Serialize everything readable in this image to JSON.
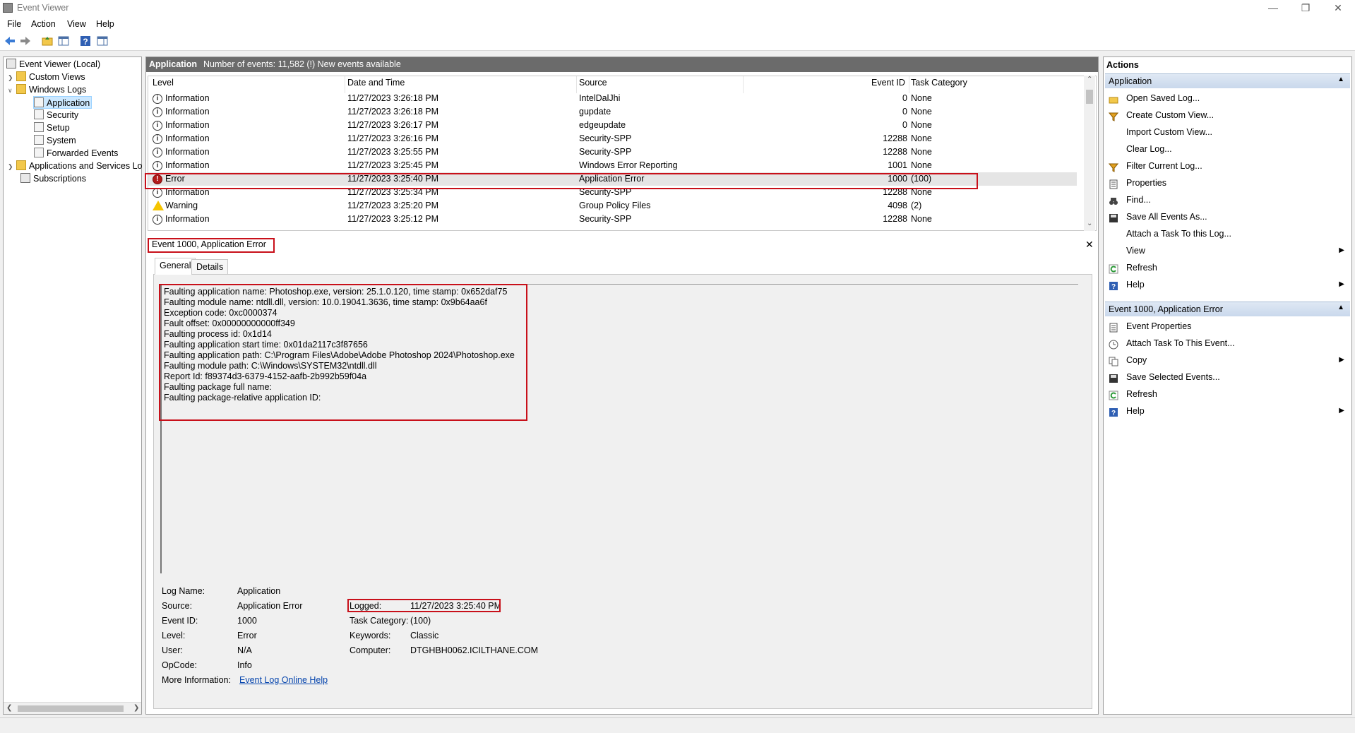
{
  "window": {
    "title": "Event Viewer"
  },
  "menu": [
    "File",
    "Action",
    "View",
    "Help"
  ],
  "toolbar": {
    "icons": [
      "back-arrow-icon",
      "forward-arrow-icon",
      "folder-up-icon",
      "show-hide-tree-icon",
      "help-icon",
      "show-hide-action-pane-icon"
    ]
  },
  "tree": {
    "root": "Event Viewer (Local)",
    "custom_views": "Custom Views",
    "windows_logs": "Windows Logs",
    "logs": [
      "Application",
      "Security",
      "Setup",
      "System",
      "Forwarded Events"
    ],
    "apps_services": "Applications and Services Lo",
    "subscriptions": "Subscriptions"
  },
  "center": {
    "header_title": "Application",
    "header_info": "Number of events: 11,582 (!) New events available",
    "columns": {
      "level": "Level",
      "datetime": "Date and Time",
      "source": "Source",
      "event_id": "Event ID",
      "task_category": "Task Category"
    },
    "rows": [
      {
        "level": "Information",
        "datetime": "11/27/2023 3:26:18 PM",
        "source": "IntelDalJhi",
        "event_id": "0",
        "task": "None",
        "type": "info"
      },
      {
        "level": "Information",
        "datetime": "11/27/2023 3:26:18 PM",
        "source": "gupdate",
        "event_id": "0",
        "task": "None",
        "type": "info"
      },
      {
        "level": "Information",
        "datetime": "11/27/2023 3:26:17 PM",
        "source": "edgeupdate",
        "event_id": "0",
        "task": "None",
        "type": "info"
      },
      {
        "level": "Information",
        "datetime": "11/27/2023 3:26:16 PM",
        "source": "Security-SPP",
        "event_id": "12288",
        "task": "None",
        "type": "info"
      },
      {
        "level": "Information",
        "datetime": "11/27/2023 3:25:55 PM",
        "source": "Security-SPP",
        "event_id": "12288",
        "task": "None",
        "type": "info"
      },
      {
        "level": "Information",
        "datetime": "11/27/2023 3:25:45 PM",
        "source": "Windows Error Reporting",
        "event_id": "1001",
        "task": "None",
        "type": "info"
      },
      {
        "level": "Error",
        "datetime": "11/27/2023 3:25:40 PM",
        "source": "Application Error",
        "event_id": "1000",
        "task": "(100)",
        "type": "error"
      },
      {
        "level": "Information",
        "datetime": "11/27/2023 3:25:34 PM",
        "source": "Security-SPP",
        "event_id": "12288",
        "task": "None",
        "type": "info"
      },
      {
        "level": "Warning",
        "datetime": "11/27/2023 3:25:20 PM",
        "source": "Group Policy Files",
        "event_id": "4098",
        "task": "(2)",
        "type": "warn"
      },
      {
        "level": "Information",
        "datetime": "11/27/2023 3:25:12 PM",
        "source": "Security-SPP",
        "event_id": "12288",
        "task": "None",
        "type": "info"
      }
    ]
  },
  "detail": {
    "title": "Event 1000, Application Error",
    "close": "✕",
    "tabs": [
      "General",
      "Details"
    ],
    "description": [
      "Faulting application name: Photoshop.exe, version: 25.1.0.120, time stamp: 0x652daf75",
      "Faulting module name: ntdll.dll, version: 10.0.19041.3636, time stamp: 0x9b64aa6f",
      "Exception code: 0xc0000374",
      "Fault offset: 0x00000000000ff349",
      "Faulting process id: 0x1d14",
      "Faulting application start time: 0x01da2117c3f87656",
      "Faulting application path: C:\\Program Files\\Adobe\\Adobe Photoshop 2024\\Photoshop.exe",
      "Faulting module path: C:\\Windows\\SYSTEM32\\ntdll.dll",
      "Report Id: f89374d3-6379-4152-aafb-2b992b59f04a",
      "Faulting package full name:",
      "Faulting package-relative application ID:"
    ],
    "props": {
      "log_name_l": "Log Name:",
      "log_name_v": "Application",
      "source_l": "Source:",
      "source_v": "Application Error",
      "logged_l": "Logged:",
      "logged_v": "11/27/2023 3:25:40 PM",
      "event_id_l": "Event ID:",
      "event_id_v": "1000",
      "task_l": "Task Category:",
      "task_v": "(100)",
      "level_l": "Level:",
      "level_v": "Error",
      "keywords_l": "Keywords:",
      "keywords_v": "Classic",
      "user_l": "User:",
      "user_v": "N/A",
      "computer_l": "Computer:",
      "computer_v": "DTGHBH0062.ICILTHANE.COM",
      "opcode_l": "OpCode:",
      "opcode_v": "Info",
      "more_l": "More Information:",
      "more_v": "Event Log Online Help"
    }
  },
  "actions": {
    "header": "Actions",
    "section1": "Application",
    "items1": [
      {
        "label": "Open Saved Log...",
        "icon": "open-folder-icon"
      },
      {
        "label": "Create Custom View...",
        "icon": "filter-icon"
      },
      {
        "label": "Import Custom View...",
        "icon": ""
      },
      {
        "label": "Clear Log...",
        "icon": ""
      },
      {
        "label": "Filter Current Log...",
        "icon": "filter-icon"
      },
      {
        "label": "Properties",
        "icon": "properties-icon"
      },
      {
        "label": "Find...",
        "icon": "binoculars-icon"
      },
      {
        "label": "Save All Events As...",
        "icon": "save-icon"
      },
      {
        "label": "Attach a Task To this Log...",
        "icon": ""
      },
      {
        "label": "View",
        "icon": "",
        "submenu": true
      },
      {
        "label": "Refresh",
        "icon": "refresh-icon"
      },
      {
        "label": "Help",
        "icon": "help-icon",
        "submenu": true
      }
    ],
    "section2": "Event 1000, Application Error",
    "items2": [
      {
        "label": "Event Properties",
        "icon": "properties-icon"
      },
      {
        "label": "Attach Task To This Event...",
        "icon": "task-icon"
      },
      {
        "label": "Copy",
        "icon": "copy-icon",
        "submenu": true
      },
      {
        "label": "Save Selected Events...",
        "icon": "save-icon"
      },
      {
        "label": "Refresh",
        "icon": "refresh-icon"
      },
      {
        "label": "Help",
        "icon": "help-icon",
        "submenu": true
      }
    ]
  }
}
